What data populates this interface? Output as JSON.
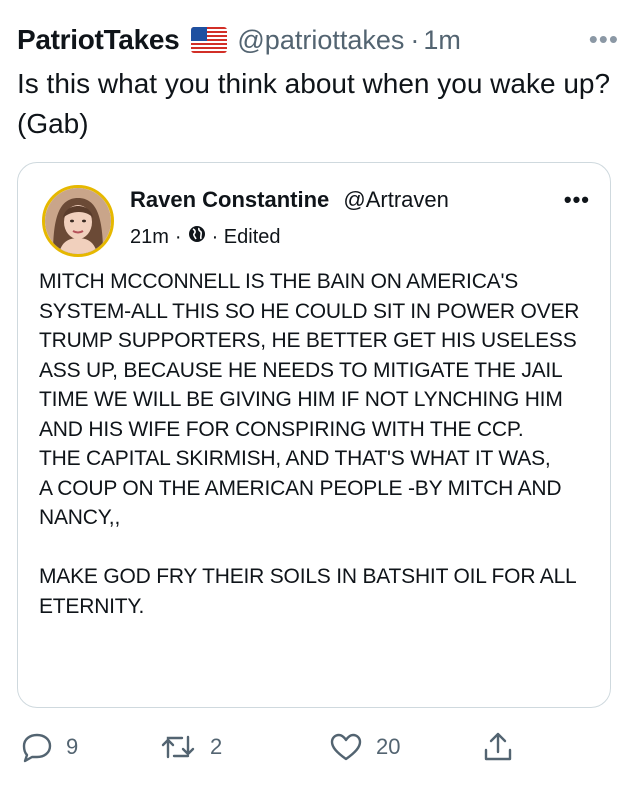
{
  "tweet": {
    "display_name": "PatriotTakes",
    "flag_icon": "us-flag-icon",
    "handle": "@patriottakes",
    "separator": "·",
    "time": "1m",
    "more_label": "•••",
    "text": "Is this what you think about when you wake up? (Gab)"
  },
  "quote": {
    "display_name": "Raven Constantine",
    "handle": "@Artraven",
    "more_label": "•••",
    "time": "21m",
    "separator": "·",
    "visibility_icon": "globe-icon",
    "edited_label": "· Edited",
    "body": "MITCH MCCONNELL IS THE BAIN ON AMERICA'S SYSTEM-ALL THIS SO HE COULD SIT IN POWER OVER TRUMP SUPPORTERS, HE BETTER GET HIS USELESS ASS UP, BECAUSE HE NEEDS TO MITIGATE THE JAIL TIME WE WILL BE GIVING HIM IF NOT LYNCHING HIM AND HIS WIFE FOR CONSPIRING WITH THE CCP.\nTHE CAPITAL SKIRMISH, AND THAT'S WHAT IT WAS,\nA COUP ON THE AMERICAN PEOPLE -BY MITCH AND NANCY,,\n\nMAKE GOD FRY THEIR SOILS IN BATSHIT OIL FOR ALL ETERNITY."
  },
  "actions": {
    "reply_count": "9",
    "retweet_count": "2",
    "like_count": "20"
  },
  "colors": {
    "text": "#0f1419",
    "secondary": "#536471",
    "border": "#cfd9de",
    "avatar_ring": "#e6b800"
  }
}
